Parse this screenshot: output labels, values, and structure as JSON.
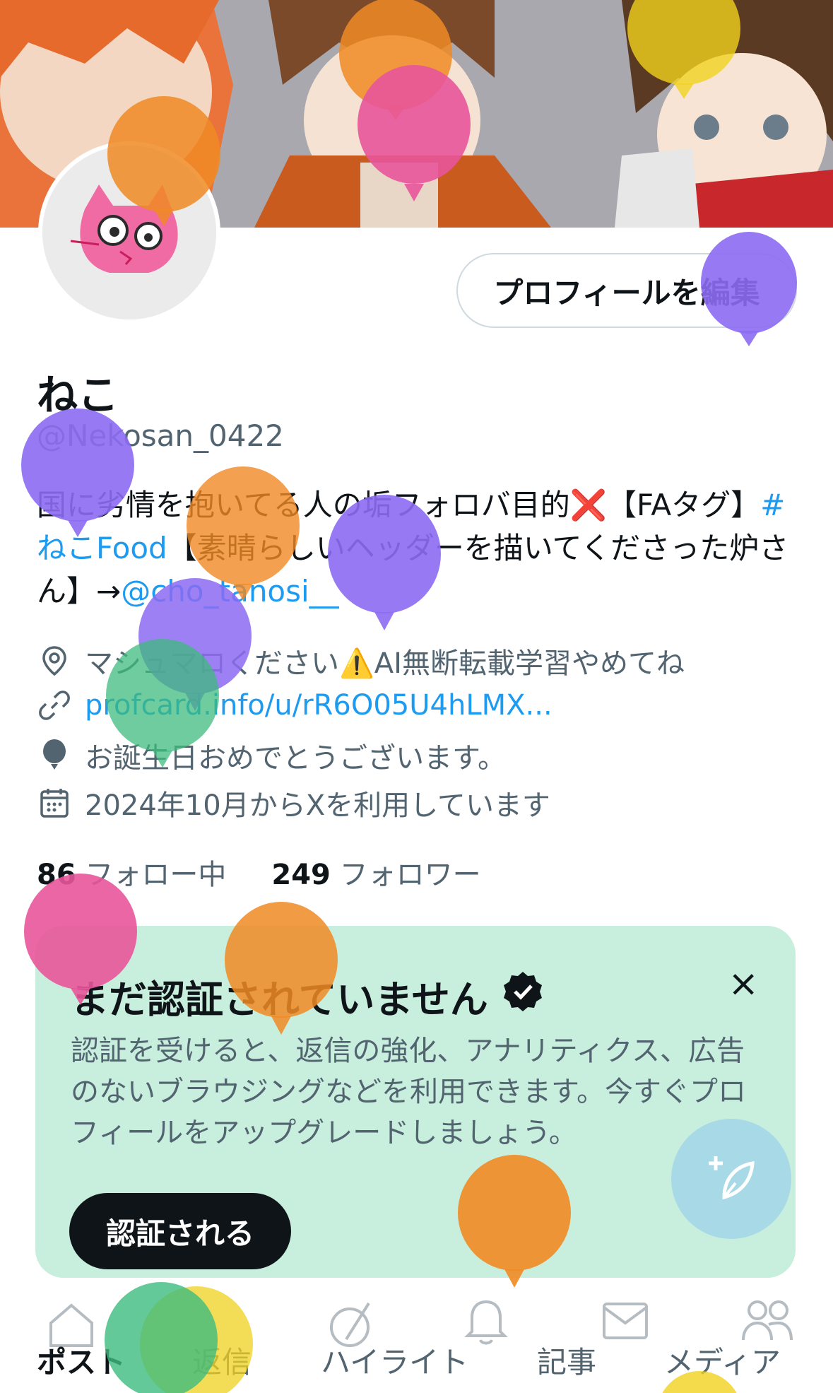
{
  "profile": {
    "name": "ねこ",
    "handle": "@Nekosan_0422",
    "edit_button": "プロフィールを編集",
    "bio": {
      "part1": "国に劣情を抱いてる人の垢フォロバ目的",
      "emoji_cross": "❌",
      "part2": "【FAタグ】",
      "hashtag": "#ねこFood",
      "part3": "【素晴らしいヘッダーを描いてくださった炉さん】→",
      "mention": "@cho_tanosi__"
    },
    "location": "マシュマロください⚠️AI無断転載学習やめてね",
    "website": "profcard.info/u/rR6O05U4hLMX...",
    "birthday": "お誕生日おめでとうございます。",
    "joined": "2024年10月からXを利用しています",
    "following_count": "86",
    "following_label": "フォロー中",
    "followers_count": "249",
    "followers_label": "フォロワー"
  },
  "verification": {
    "title": "まだ認証されていません",
    "body": "認証を受けると、返信の強化、アナリティクス、広告のないブラウジングなどを利用できます。今すぐプロフィールをアップグレードしましょう。",
    "button": "認証される",
    "close": "×"
  },
  "tabs": [
    "ポスト",
    "返信",
    "ハイライト",
    "記事",
    "メディア"
  ],
  "colors": {
    "accent": "#1d9bf0",
    "banner_green": "#c8efdd",
    "fab": "#a7d9e6"
  },
  "icons": [
    "location-pin-icon",
    "link-icon",
    "balloon-icon",
    "calendar-icon",
    "verified-badge-icon",
    "close-icon",
    "compose-icon"
  ]
}
